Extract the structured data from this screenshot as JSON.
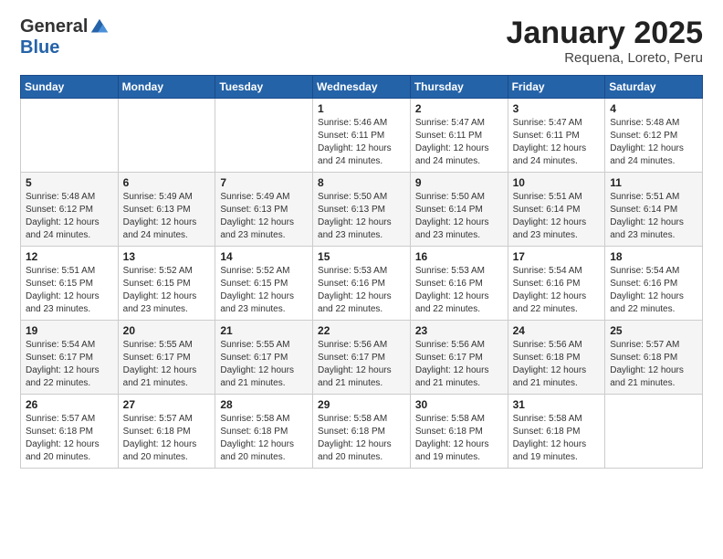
{
  "logo": {
    "general": "General",
    "blue": "Blue"
  },
  "header": {
    "title": "January 2025",
    "subtitle": "Requena, Loreto, Peru"
  },
  "weekdays": [
    "Sunday",
    "Monday",
    "Tuesday",
    "Wednesday",
    "Thursday",
    "Friday",
    "Saturday"
  ],
  "weeks": [
    [
      {
        "day": "",
        "info": ""
      },
      {
        "day": "",
        "info": ""
      },
      {
        "day": "",
        "info": ""
      },
      {
        "day": "1",
        "info": "Sunrise: 5:46 AM\nSunset: 6:11 PM\nDaylight: 12 hours and 24 minutes."
      },
      {
        "day": "2",
        "info": "Sunrise: 5:47 AM\nSunset: 6:11 PM\nDaylight: 12 hours and 24 minutes."
      },
      {
        "day": "3",
        "info": "Sunrise: 5:47 AM\nSunset: 6:11 PM\nDaylight: 12 hours and 24 minutes."
      },
      {
        "day": "4",
        "info": "Sunrise: 5:48 AM\nSunset: 6:12 PM\nDaylight: 12 hours and 24 minutes."
      }
    ],
    [
      {
        "day": "5",
        "info": "Sunrise: 5:48 AM\nSunset: 6:12 PM\nDaylight: 12 hours and 24 minutes."
      },
      {
        "day": "6",
        "info": "Sunrise: 5:49 AM\nSunset: 6:13 PM\nDaylight: 12 hours and 24 minutes."
      },
      {
        "day": "7",
        "info": "Sunrise: 5:49 AM\nSunset: 6:13 PM\nDaylight: 12 hours and 23 minutes."
      },
      {
        "day": "8",
        "info": "Sunrise: 5:50 AM\nSunset: 6:13 PM\nDaylight: 12 hours and 23 minutes."
      },
      {
        "day": "9",
        "info": "Sunrise: 5:50 AM\nSunset: 6:14 PM\nDaylight: 12 hours and 23 minutes."
      },
      {
        "day": "10",
        "info": "Sunrise: 5:51 AM\nSunset: 6:14 PM\nDaylight: 12 hours and 23 minutes."
      },
      {
        "day": "11",
        "info": "Sunrise: 5:51 AM\nSunset: 6:14 PM\nDaylight: 12 hours and 23 minutes."
      }
    ],
    [
      {
        "day": "12",
        "info": "Sunrise: 5:51 AM\nSunset: 6:15 PM\nDaylight: 12 hours and 23 minutes."
      },
      {
        "day": "13",
        "info": "Sunrise: 5:52 AM\nSunset: 6:15 PM\nDaylight: 12 hours and 23 minutes."
      },
      {
        "day": "14",
        "info": "Sunrise: 5:52 AM\nSunset: 6:15 PM\nDaylight: 12 hours and 23 minutes."
      },
      {
        "day": "15",
        "info": "Sunrise: 5:53 AM\nSunset: 6:16 PM\nDaylight: 12 hours and 22 minutes."
      },
      {
        "day": "16",
        "info": "Sunrise: 5:53 AM\nSunset: 6:16 PM\nDaylight: 12 hours and 22 minutes."
      },
      {
        "day": "17",
        "info": "Sunrise: 5:54 AM\nSunset: 6:16 PM\nDaylight: 12 hours and 22 minutes."
      },
      {
        "day": "18",
        "info": "Sunrise: 5:54 AM\nSunset: 6:16 PM\nDaylight: 12 hours and 22 minutes."
      }
    ],
    [
      {
        "day": "19",
        "info": "Sunrise: 5:54 AM\nSunset: 6:17 PM\nDaylight: 12 hours and 22 minutes."
      },
      {
        "day": "20",
        "info": "Sunrise: 5:55 AM\nSunset: 6:17 PM\nDaylight: 12 hours and 21 minutes."
      },
      {
        "day": "21",
        "info": "Sunrise: 5:55 AM\nSunset: 6:17 PM\nDaylight: 12 hours and 21 minutes."
      },
      {
        "day": "22",
        "info": "Sunrise: 5:56 AM\nSunset: 6:17 PM\nDaylight: 12 hours and 21 minutes."
      },
      {
        "day": "23",
        "info": "Sunrise: 5:56 AM\nSunset: 6:17 PM\nDaylight: 12 hours and 21 minutes."
      },
      {
        "day": "24",
        "info": "Sunrise: 5:56 AM\nSunset: 6:18 PM\nDaylight: 12 hours and 21 minutes."
      },
      {
        "day": "25",
        "info": "Sunrise: 5:57 AM\nSunset: 6:18 PM\nDaylight: 12 hours and 21 minutes."
      }
    ],
    [
      {
        "day": "26",
        "info": "Sunrise: 5:57 AM\nSunset: 6:18 PM\nDaylight: 12 hours and 20 minutes."
      },
      {
        "day": "27",
        "info": "Sunrise: 5:57 AM\nSunset: 6:18 PM\nDaylight: 12 hours and 20 minutes."
      },
      {
        "day": "28",
        "info": "Sunrise: 5:58 AM\nSunset: 6:18 PM\nDaylight: 12 hours and 20 minutes."
      },
      {
        "day": "29",
        "info": "Sunrise: 5:58 AM\nSunset: 6:18 PM\nDaylight: 12 hours and 20 minutes."
      },
      {
        "day": "30",
        "info": "Sunrise: 5:58 AM\nSunset: 6:18 PM\nDaylight: 12 hours and 19 minutes."
      },
      {
        "day": "31",
        "info": "Sunrise: 5:58 AM\nSunset: 6:18 PM\nDaylight: 12 hours and 19 minutes."
      },
      {
        "day": "",
        "info": ""
      }
    ]
  ]
}
